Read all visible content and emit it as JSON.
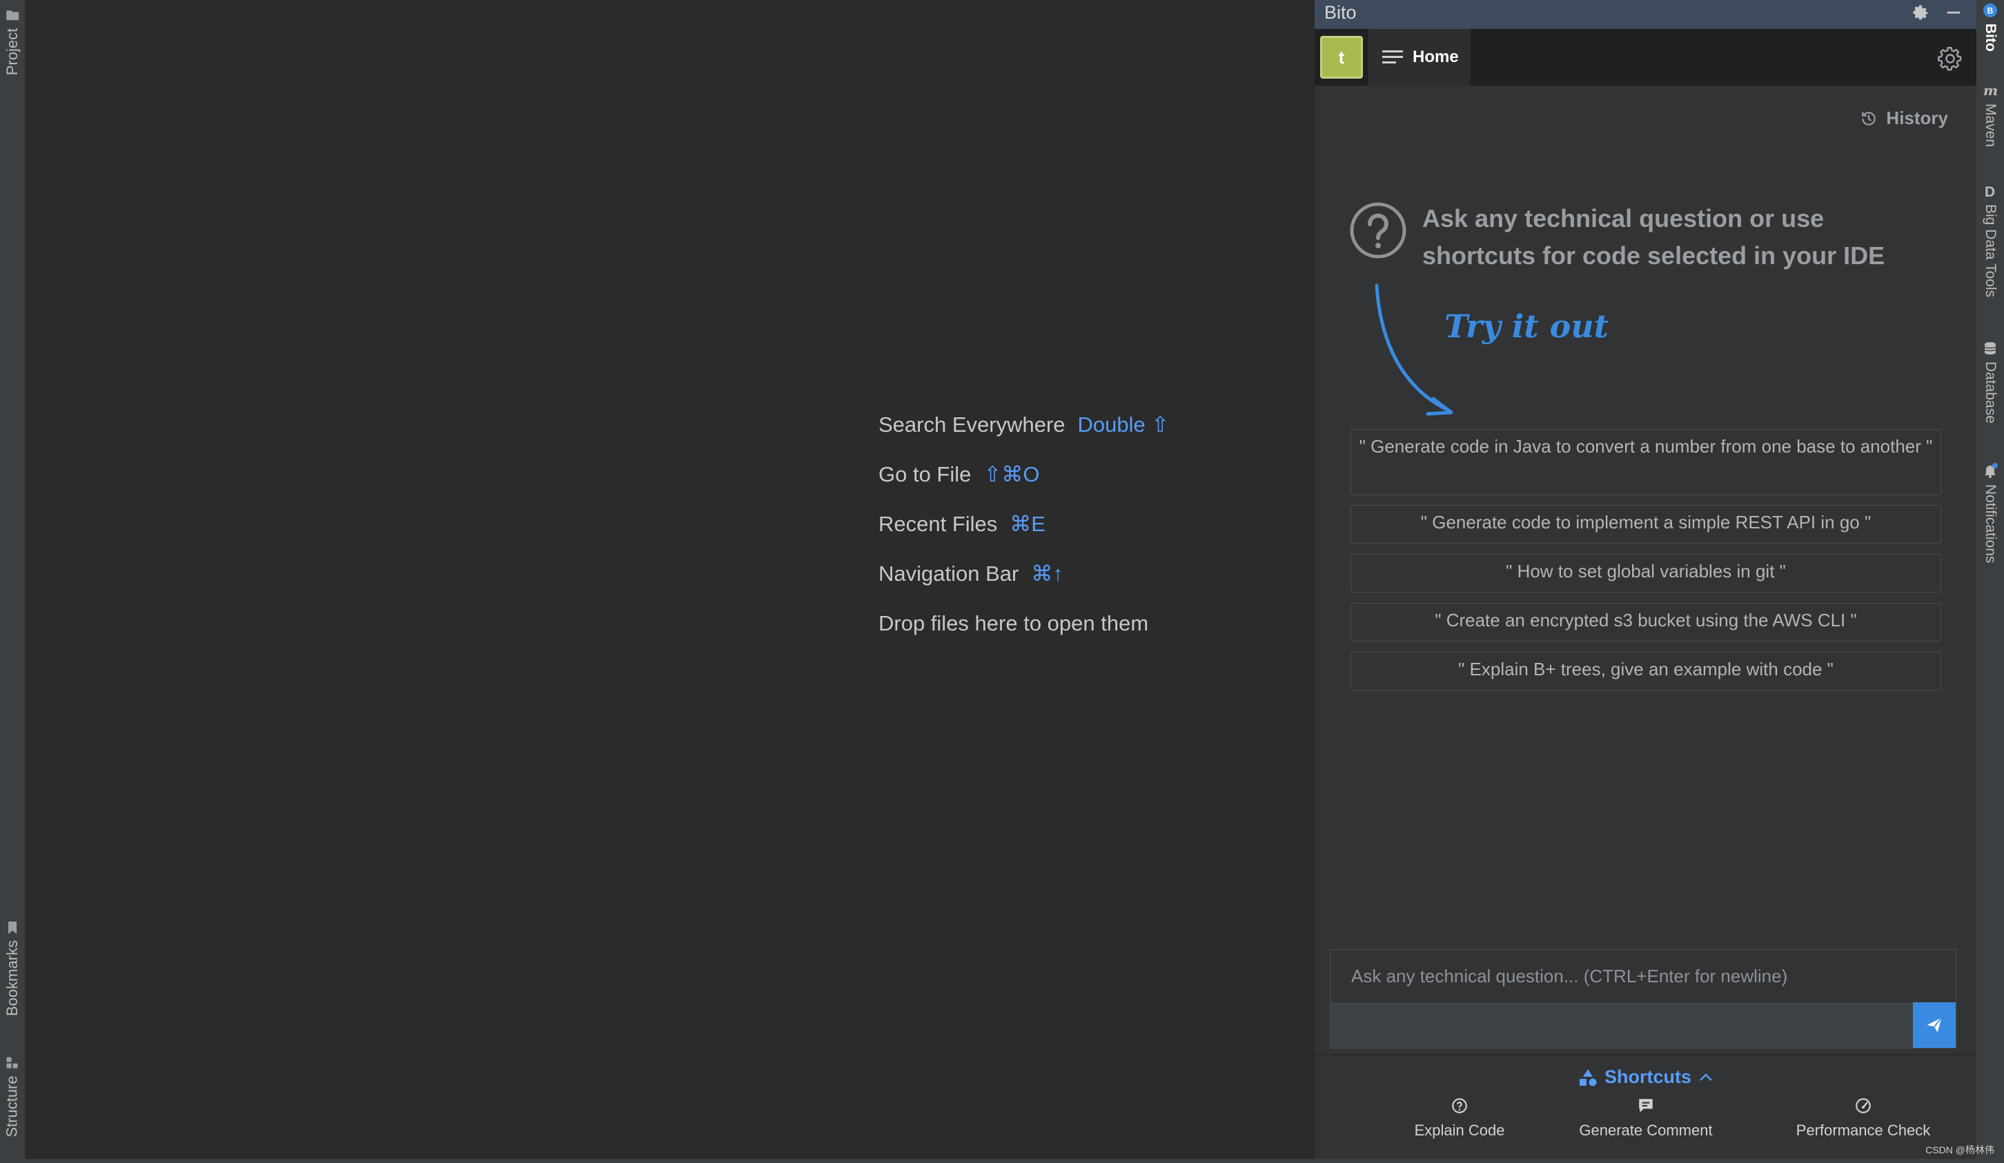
{
  "left_sidebar": {
    "project_label": "Project",
    "bookmarks_label": "Bookmarks",
    "structure_label": "Structure"
  },
  "editor": {
    "hints": [
      {
        "label": "Search Everywhere",
        "shortcut": "Double ⇧"
      },
      {
        "label": "Go to File",
        "shortcut": "⇧⌘O"
      },
      {
        "label": "Recent Files",
        "shortcut": "⌘E"
      },
      {
        "label": "Navigation Bar",
        "shortcut": "⌘↑"
      },
      {
        "label": "Drop files here to open them",
        "shortcut": ""
      }
    ]
  },
  "bito": {
    "title": "Bito",
    "avatar_letter": "t",
    "home_tab": "Home",
    "history_label": "History",
    "intro_text": "Ask any technical question or use shortcuts for code selected in your IDE",
    "try_it_out": "Try it out",
    "prompts": [
      "\" Generate code in Java to convert a number from one base to another \"",
      "\" Generate code to implement a simple REST API in go \"",
      "\" How to set global variables in git \"",
      "\" Create an encrypted s3 bucket using the AWS CLI \"",
      "\" Explain B+ trees, give an example with code \""
    ],
    "input_placeholder": "Ask any technical question... (CTRL+Enter for newline)",
    "shortcuts_label": "Shortcuts",
    "actions": [
      {
        "label": "Explain Code",
        "icon": "question-bubble-icon"
      },
      {
        "label": "Generate Comment",
        "icon": "comment-icon"
      },
      {
        "label": "Performance Check",
        "icon": "gauge-icon"
      }
    ]
  },
  "right_sidebar": {
    "tabs": [
      "Bito",
      "Maven",
      "Big Data Tools",
      "Database",
      "Notifications"
    ]
  },
  "watermark": "CSDN @杨林伟",
  "colors": {
    "accent_blue": "#589df6",
    "send_button": "#3a8be0",
    "avatar": "#a9b950",
    "title_bar": "#3d4b5c"
  }
}
